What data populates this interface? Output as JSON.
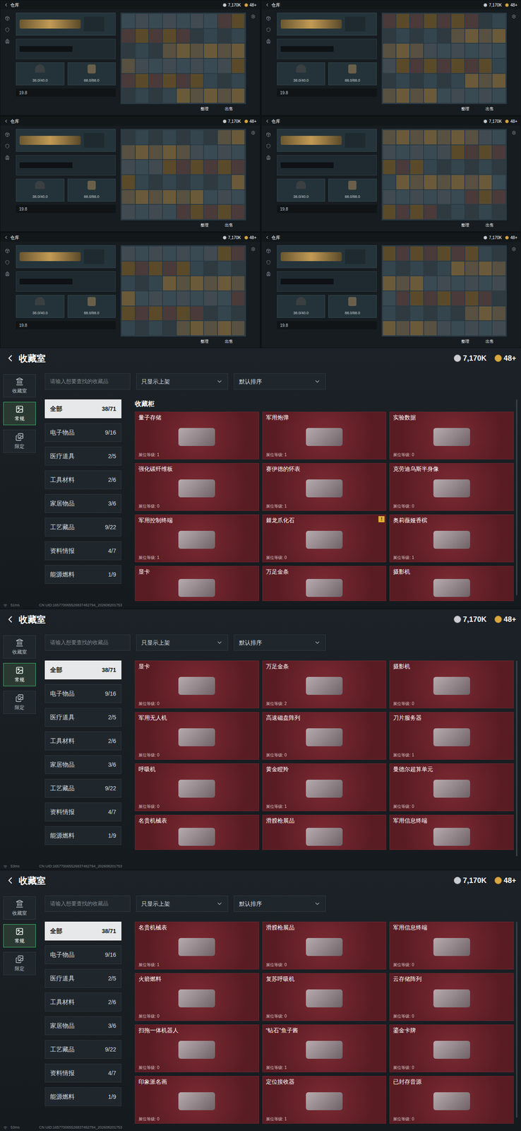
{
  "warehouse_shots": [
    {
      "title": "仓库",
      "currency": "7,170K",
      "coins": "48+",
      "helmet": "38.0/40.0",
      "armor": "88.0/88.0",
      "weight": "19.8",
      "buttons": [
        "整理",
        "出售"
      ]
    },
    {
      "title": "仓库",
      "currency": "7,170K",
      "coins": "48+",
      "helmet": "38.0/40.0",
      "armor": "88.0/88.0",
      "weight": "19.8",
      "buttons": [
        "整理",
        "出售"
      ]
    },
    {
      "title": "仓库",
      "currency": "7,170K",
      "coins": "48+",
      "helmet": "38.0/40.0",
      "armor": "88.0/88.0",
      "weight": "19.8",
      "buttons": [
        "整理",
        "出售"
      ]
    },
    {
      "title": "仓库",
      "currency": "7,170K",
      "coins": "48+",
      "helmet": "38.0/40.0",
      "armor": "88.0/88.0",
      "weight": "19.8",
      "buttons": [
        "整理",
        "出售"
      ]
    },
    {
      "title": "仓库",
      "currency": "7,170K",
      "coins": "48+",
      "helmet": "38.0/40.0",
      "armor": "88.0/88.0",
      "weight": "19.8",
      "buttons": [
        "整理",
        "出售"
      ]
    },
    {
      "title": "仓库",
      "currency": "7,170K",
      "coins": "48+",
      "helmet": "38.0/40.0",
      "armor": "88.0/88.0",
      "weight": "19.8",
      "buttons": [
        "整理",
        "出售"
      ]
    }
  ],
  "collection_panels": [
    {
      "title": "收藏室",
      "currency": "7,170K",
      "coins": "48+",
      "nav": [
        {
          "label": "收藏室",
          "selected": false
        },
        {
          "label": "常规",
          "selected": true
        },
        {
          "label": "限定",
          "selected": false
        }
      ],
      "search": {
        "placeholder": "请输入想要查找的收藏品"
      },
      "filters": [
        "只显示上架",
        "默认排序"
      ],
      "categories": [
        {
          "label": "全部",
          "count": "38/71",
          "selected": true
        },
        {
          "label": "电子物品",
          "count": "9/16",
          "selected": false
        },
        {
          "label": "医疗道具",
          "count": "2/5",
          "selected": false
        },
        {
          "label": "工具材料",
          "count": "2/6",
          "selected": false
        },
        {
          "label": "家居物品",
          "count": "3/6",
          "selected": false
        },
        {
          "label": "工艺藏品",
          "count": "9/22",
          "selected": false
        },
        {
          "label": "资料情报",
          "count": "4/7",
          "selected": false
        },
        {
          "label": "能源燃料",
          "count": "1/9",
          "selected": false
        }
      ],
      "heading": "收藏柜",
      "cards": [
        {
          "name": "量子存储",
          "level": "展位等级: 1",
          "partial": false,
          "badge": ""
        },
        {
          "name": "军用炮弹",
          "level": "展位等级: 1",
          "partial": false,
          "badge": ""
        },
        {
          "name": "实验数据",
          "level": "展位等级: 0",
          "partial": false,
          "badge": ""
        },
        {
          "name": "强化碳纤维板",
          "level": "展位等级: 0",
          "partial": false,
          "badge": ""
        },
        {
          "name": "赛伊德的怀表",
          "level": "展位等级: 1",
          "partial": false,
          "badge": ""
        },
        {
          "name": "克劳迪乌斯半身像",
          "level": "展位等级: 0",
          "partial": false,
          "badge": ""
        },
        {
          "name": "军用控制终端",
          "level": "展位等级: 1",
          "partial": false,
          "badge": ""
        },
        {
          "name": "棘龙爪化石",
          "level": "展位等级: 0",
          "partial": false,
          "badge": "!"
        },
        {
          "name": "奥莉薇娅香槟",
          "level": "展位等级: 1",
          "partial": false,
          "badge": ""
        },
        {
          "name": "显卡",
          "level": "",
          "partial": true,
          "badge": ""
        },
        {
          "name": "万足金条",
          "level": "",
          "partial": true,
          "badge": ""
        },
        {
          "name": "摄影机",
          "level": "",
          "partial": true,
          "badge": ""
        }
      ],
      "footer": {
        "ping": "51ms",
        "uid": "CN UID:165770065526837482794_202608201753"
      }
    },
    {
      "title": "收藏室",
      "currency": "7,170K",
      "coins": "48+",
      "nav": [
        {
          "label": "收藏室",
          "selected": false
        },
        {
          "label": "常规",
          "selected": true
        },
        {
          "label": "限定",
          "selected": false
        }
      ],
      "search": {
        "placeholder": "请输入想要查找的收藏品"
      },
      "filters": [
        "只显示上架",
        "默认排序"
      ],
      "categories": [
        {
          "label": "全部",
          "count": "38/71",
          "selected": true
        },
        {
          "label": "电子物品",
          "count": "9/16",
          "selected": false
        },
        {
          "label": "医疗道具",
          "count": "2/5",
          "selected": false
        },
        {
          "label": "工具材料",
          "count": "2/6",
          "selected": false
        },
        {
          "label": "家居物品",
          "count": "3/6",
          "selected": false
        },
        {
          "label": "工艺藏品",
          "count": "9/22",
          "selected": false
        },
        {
          "label": "资料情报",
          "count": "4/7",
          "selected": false
        },
        {
          "label": "能源燃料",
          "count": "1/9",
          "selected": false
        }
      ],
      "heading": "",
      "cards": [
        {
          "name": "显卡",
          "level": "展位等级: 0",
          "partial": false,
          "badge": ""
        },
        {
          "name": "万足金条",
          "level": "展位等级: 2",
          "partial": false,
          "badge": ""
        },
        {
          "name": "摄影机",
          "level": "展位等级: 0",
          "partial": false,
          "badge": ""
        },
        {
          "name": "军用无人机",
          "level": "展位等级: 0",
          "partial": false,
          "badge": ""
        },
        {
          "name": "高速磁盘阵列",
          "level": "展位等级: 0",
          "partial": false,
          "badge": ""
        },
        {
          "name": "刀片服务器",
          "level": "展位等级: 1",
          "partial": false,
          "badge": ""
        },
        {
          "name": "呼吸机",
          "level": "展位等级: 0",
          "partial": false,
          "badge": ""
        },
        {
          "name": "黄金瞪羚",
          "level": "展位等级: 1",
          "partial": false,
          "badge": ""
        },
        {
          "name": "曼德尔超算单元",
          "level": "展位等级: 0",
          "partial": false,
          "badge": ""
        },
        {
          "name": "名贵机械表",
          "level": "",
          "partial": true,
          "badge": ""
        },
        {
          "name": "滑膛枪展品",
          "level": "",
          "partial": true,
          "badge": ""
        },
        {
          "name": "军用信息终端",
          "level": "",
          "partial": true,
          "badge": ""
        }
      ],
      "footer": {
        "ping": "53ms",
        "uid": "CN UID:165770065526837482794_202608201753"
      }
    },
    {
      "title": "收藏室",
      "currency": "7,170K",
      "coins": "48+",
      "nav": [
        {
          "label": "收藏室",
          "selected": false
        },
        {
          "label": "常规",
          "selected": true
        },
        {
          "label": "限定",
          "selected": false
        }
      ],
      "search": {
        "placeholder": "请输入想要查找的收藏品"
      },
      "filters": [
        "只显示上架",
        "默认排序"
      ],
      "categories": [
        {
          "label": "全部",
          "count": "38/71",
          "selected": true
        },
        {
          "label": "电子物品",
          "count": "9/16",
          "selected": false
        },
        {
          "label": "医疗道具",
          "count": "2/5",
          "selected": false
        },
        {
          "label": "工具材料",
          "count": "2/6",
          "selected": false
        },
        {
          "label": "家居物品",
          "count": "3/6",
          "selected": false
        },
        {
          "label": "工艺藏品",
          "count": "9/22",
          "selected": false
        },
        {
          "label": "资料情报",
          "count": "4/7",
          "selected": false
        },
        {
          "label": "能源燃料",
          "count": "1/9",
          "selected": false
        }
      ],
      "heading": "",
      "cards": [
        {
          "name": "名贵机械表",
          "level": "展位等级: 1",
          "partial": false,
          "badge": ""
        },
        {
          "name": "滑膛枪展品",
          "level": "展位等级: 0",
          "partial": false,
          "badge": ""
        },
        {
          "name": "军用信息终端",
          "level": "展位等级: 0",
          "partial": false,
          "badge": ""
        },
        {
          "name": "火箭燃料",
          "level": "展位等级: 0",
          "partial": false,
          "badge": ""
        },
        {
          "name": "复苏呼吸机",
          "level": "展位等级: 0",
          "partial": false,
          "badge": ""
        },
        {
          "name": "云存储阵列",
          "level": "展位等级: 0",
          "partial": false,
          "badge": ""
        },
        {
          "name": "扫拖一体机器人",
          "level": "展位等级: 0",
          "partial": false,
          "badge": ""
        },
        {
          "name": "“钻石”鱼子酱",
          "level": "展位等级: 1",
          "partial": false,
          "badge": ""
        },
        {
          "name": "鎏金卡牌",
          "level": "展位等级: 0",
          "partial": false,
          "badge": ""
        },
        {
          "name": "印象派名画",
          "level": "展位等级: 0",
          "partial": false,
          "badge": ""
        },
        {
          "name": "定位接收器",
          "level": "展位等级: 1",
          "partial": false,
          "badge": ""
        },
        {
          "name": "已封存音源",
          "level": "展位等级: 0",
          "partial": false,
          "badge": ""
        }
      ],
      "footer": {
        "ping": "53ms",
        "uid": "CN UID:165770065526837482794_202608201753"
      }
    }
  ]
}
